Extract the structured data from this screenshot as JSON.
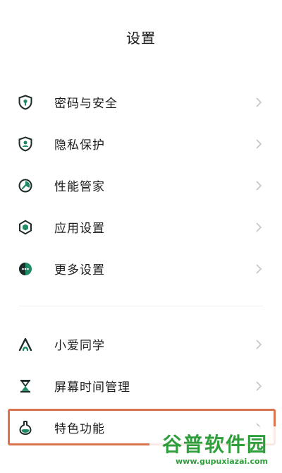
{
  "header": {
    "title": "设置"
  },
  "groups": [
    {
      "items": [
        {
          "label": "密码与安全",
          "icon": "shield-lock-icon"
        },
        {
          "label": "隐私保护",
          "icon": "privacy-shield-icon"
        },
        {
          "label": "性能管家",
          "icon": "performance-icon"
        },
        {
          "label": "应用设置",
          "icon": "app-settings-icon"
        },
        {
          "label": "更多设置",
          "icon": "more-settings-icon"
        }
      ]
    },
    {
      "items": [
        {
          "label": "小爱同学",
          "icon": "xiaoai-icon"
        },
        {
          "label": "屏幕时间管理",
          "icon": "hourglass-icon"
        },
        {
          "label": "特色功能",
          "icon": "flask-icon"
        }
      ]
    }
  ],
  "highlighted_item": "特色功能",
  "watermark": {
    "main": "谷普软件园",
    "sub": "www.gupuxiazai.com"
  },
  "colors": {
    "icon_primary": "#1f8a64",
    "icon_dark": "#1d2b2a",
    "highlight_border": "#d9744f",
    "watermark": "#2e9f3b"
  }
}
